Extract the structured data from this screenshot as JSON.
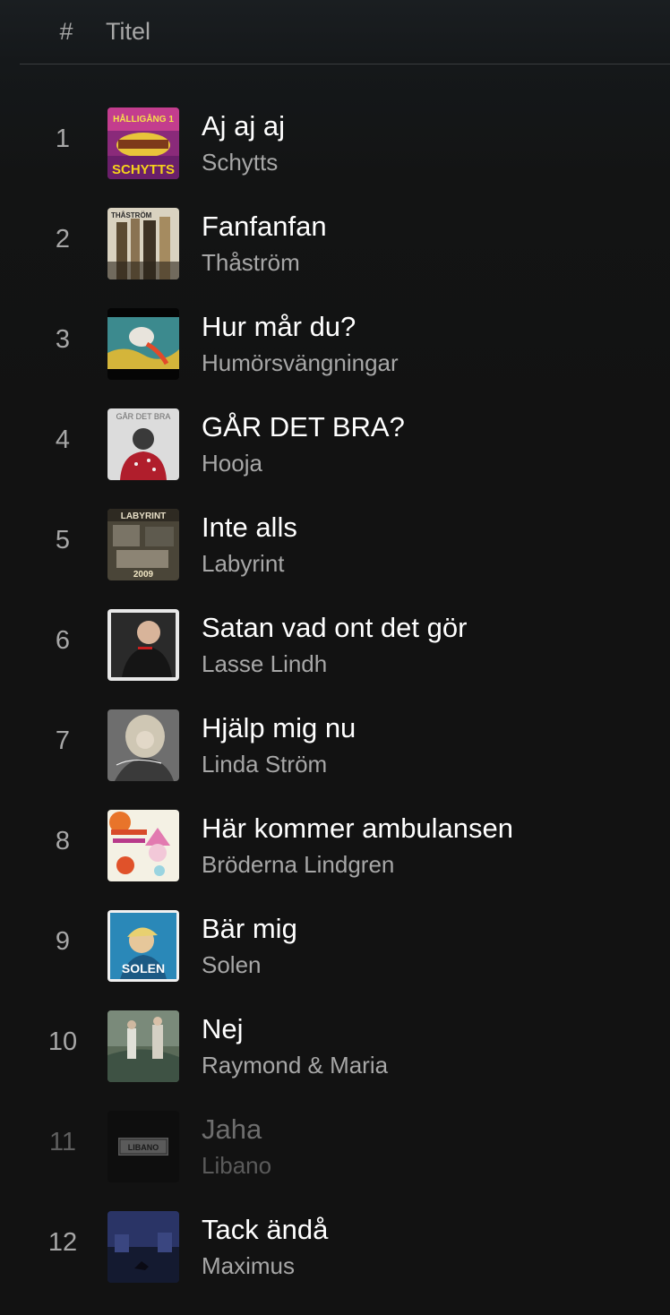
{
  "header": {
    "number_label": "#",
    "title_label": "Titel"
  },
  "tracks": [
    {
      "number": "1",
      "title": "Aj aj aj",
      "artist": "Schytts",
      "playable": true,
      "art_text": "SCHYTTS",
      "art_text_top": "HÅLLIGÅNG 1"
    },
    {
      "number": "2",
      "title": "Fanfanfan",
      "artist": "Thåström",
      "playable": true,
      "art_text": "THÅSTRÖM"
    },
    {
      "number": "3",
      "title": "Hur mår du?",
      "artist": "Humörsvängningar",
      "playable": true
    },
    {
      "number": "4",
      "title": "GÅR DET BRA?",
      "artist": "Hooja",
      "playable": true,
      "art_text": "GÅR DET BRA"
    },
    {
      "number": "5",
      "title": "Inte alls",
      "artist": "Labyrint",
      "playable": true,
      "art_text": "LABYRINT",
      "art_text_bottom": "2009"
    },
    {
      "number": "6",
      "title": "Satan vad ont det gör",
      "artist": "Lasse Lindh",
      "playable": true
    },
    {
      "number": "7",
      "title": "Hjälp mig nu",
      "artist": "Linda Ström",
      "playable": true
    },
    {
      "number": "8",
      "title": "Här kommer ambulansen",
      "artist": "Bröderna Lindgren",
      "playable": true
    },
    {
      "number": "9",
      "title": "Bär mig",
      "artist": "Solen",
      "playable": true,
      "art_text": "SOLEN"
    },
    {
      "number": "10",
      "title": "Nej",
      "artist": "Raymond & Maria",
      "playable": true
    },
    {
      "number": "11",
      "title": "Jaha",
      "artist": "Libano",
      "playable": false,
      "art_text": "LIBANO"
    },
    {
      "number": "12",
      "title": "Tack ändå",
      "artist": "Maximus",
      "playable": true
    }
  ],
  "colors": {
    "background": "#121212",
    "text_primary": "#ffffff",
    "text_secondary": "#a7a7a7",
    "text_disabled": "#6e6e6e"
  }
}
